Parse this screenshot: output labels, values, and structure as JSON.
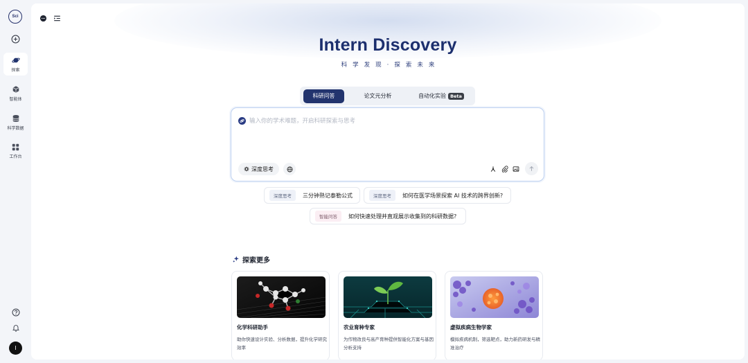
{
  "app": {
    "logo_text": "Sci",
    "avatar_initial": "I"
  },
  "sidebar": {
    "items": [
      {
        "label": "探索",
        "icon": "planet-icon",
        "active": true
      },
      {
        "label": "智能体",
        "icon": "cube-icon",
        "active": false
      },
      {
        "label": "科学数据",
        "icon": "database-icon",
        "active": false
      },
      {
        "label": "工作台",
        "icon": "grid-icon",
        "active": false
      }
    ],
    "bottom_icons": [
      "help-icon",
      "bell-icon"
    ]
  },
  "hero": {
    "title": "Intern Discovery",
    "subtitle": "科学发现·探索未来"
  },
  "tabs": [
    {
      "label": "科研问答",
      "active": true
    },
    {
      "label": "论文元分析",
      "active": false
    },
    {
      "label": "自动化实验",
      "active": false,
      "badge": "Beta"
    }
  ],
  "input": {
    "placeholder": "输入你的学术难题，开启科研探索与思考",
    "deep_think_label": "深度思考"
  },
  "suggestions": [
    {
      "tag": "深度思考",
      "text": "三分钟熟记泰勒公式"
    },
    {
      "tag": "深度思考",
      "text": "如何在医学场景探索 AI 技术的跨界创新?"
    },
    {
      "tag": "智能问答",
      "text": "如何快速处理并直观展示收集到的科研数据?"
    }
  ],
  "explore": {
    "title": "探索更多",
    "cards": [
      {
        "title": "化学科研助手",
        "desc": "助你快速设计实验、分析数据，提升化学研究效率"
      },
      {
        "title": "农业育种专家",
        "desc": "为作物改良与高产育种提供智能化方案与基因分析支持"
      },
      {
        "title": "虚拟疾病生物学家",
        "desc": "模拟疾病机制，筛选靶点，助力新药研发与精准治疗"
      }
    ]
  },
  "colors": {
    "brand": "#1c2f6e",
    "active_tab": "#22346e",
    "input_border": "#bcd0f0"
  }
}
